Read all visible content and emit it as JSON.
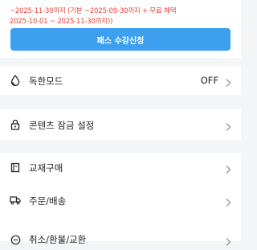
{
  "notice": {
    "line1": "~2025-11-30까지 (기본 ~2025-09-30까지 + 무료 혜택",
    "line2": "2025-10-01 ~ 2025-11-30까지))"
  },
  "pass_button": {
    "label": "패스 수강신청"
  },
  "menu": {
    "dark_mode": {
      "label": "독한모드",
      "value": "OFF",
      "icon": "drop-icon"
    },
    "content_lock": {
      "label": "콘텐츠 잠금 설정",
      "icon": "lock-icon"
    },
    "textbook": {
      "label": "교재구매",
      "icon": "book-icon"
    },
    "order": {
      "label": "주문/배송",
      "icon": "truck-icon"
    },
    "cancel": {
      "label": "취소/환불/교환",
      "icon": "refund-icon"
    }
  },
  "colors": {
    "accent": "#3d9ff0",
    "notice_red": "#e8433b",
    "background": "#f4f5f7"
  }
}
